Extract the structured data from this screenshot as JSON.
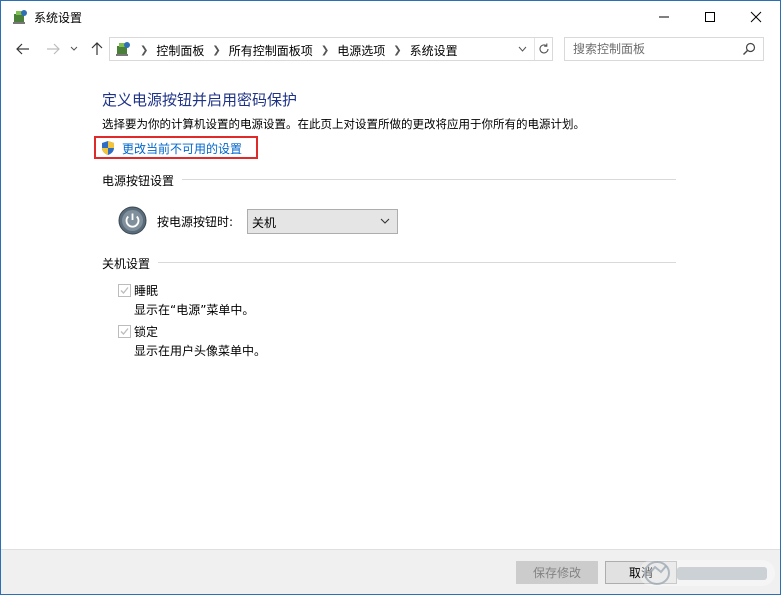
{
  "window": {
    "title": "系统设置",
    "controls": {
      "minimize": "—",
      "maximize": "☐",
      "close": "✕"
    }
  },
  "nav": {
    "breadcrumbs": [
      "控制面板",
      "所有控制面板项",
      "电源选项",
      "系统设置"
    ],
    "search_placeholder": "搜索控制面板"
  },
  "content": {
    "heading": "定义电源按钮并启用密码保护",
    "description": "选择要为你的计算机设置的电源设置。在此页上对设置所做的更改将应用于你所有的电源计划。",
    "change_link": "更改当前不可用的设置",
    "power_section": {
      "title": "电源按钮设置",
      "label": "按电源按钮时:",
      "selected": "关机"
    },
    "shutdown_section": {
      "title": "关机设置",
      "options": [
        {
          "label": "睡眠",
          "description": "显示在“电源”菜单中。",
          "checked": true,
          "disabled": true
        },
        {
          "label": "锁定",
          "description": "显示在用户头像菜单中。",
          "checked": true,
          "disabled": true
        }
      ]
    }
  },
  "footer": {
    "save_label": "保存修改",
    "cancel_label": "取消"
  },
  "colors": {
    "heading": "#1e3287",
    "link": "#0066cc",
    "highlight_box": "#e02a2a"
  }
}
